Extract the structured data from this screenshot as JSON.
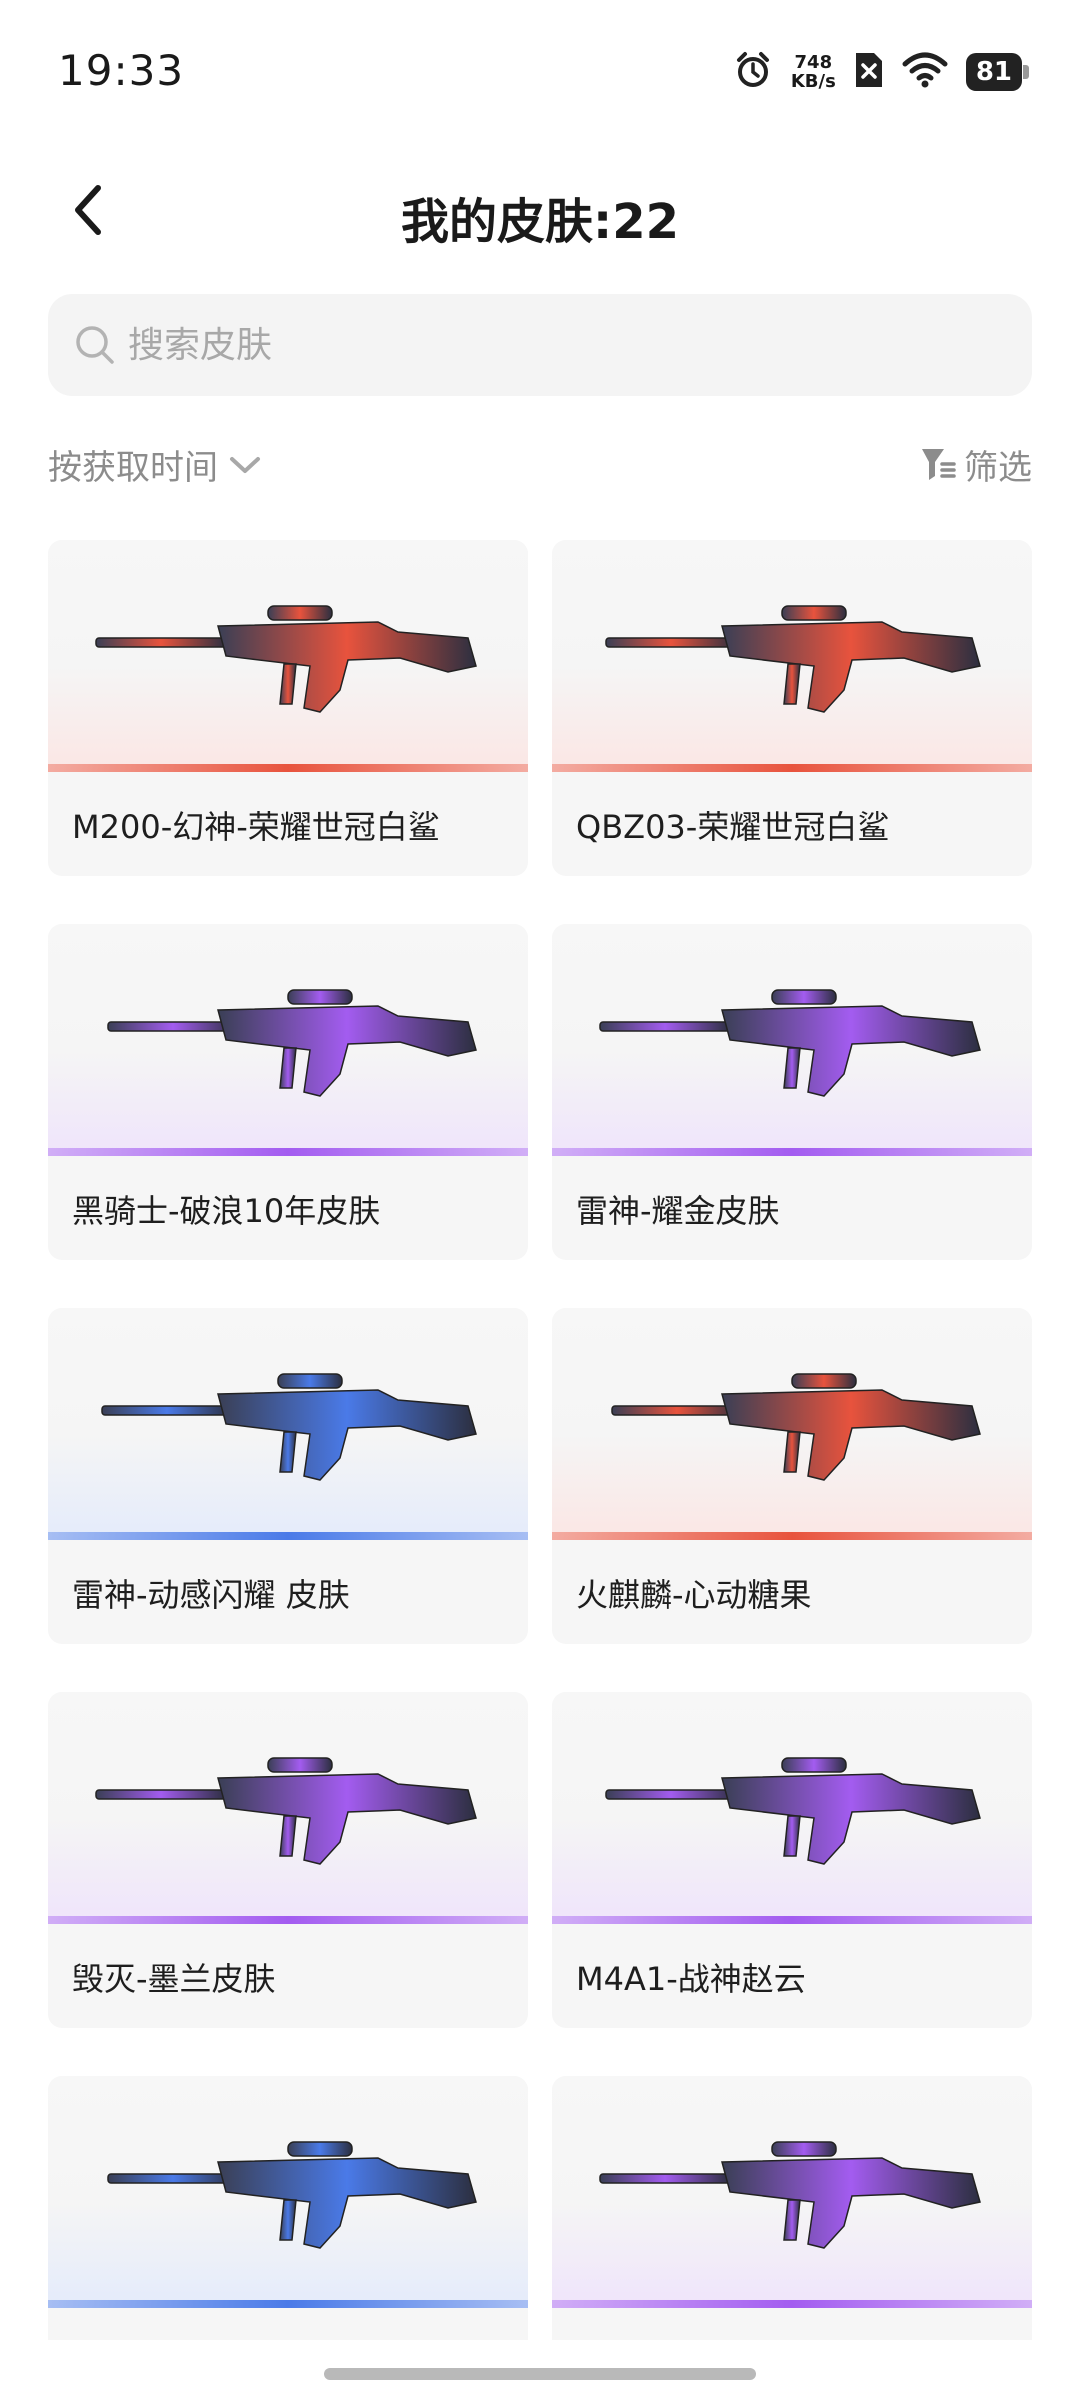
{
  "status_bar": {
    "time": "19:33",
    "speed_value": "748",
    "speed_unit": "KB/s",
    "battery": "81",
    "icons": [
      "alarm-icon",
      "network-speed",
      "sim-off-icon",
      "wifi-icon",
      "battery-icon"
    ]
  },
  "header": {
    "title": "我的皮肤:22",
    "back_icon": "chevron-left-icon"
  },
  "search": {
    "placeholder": "搜索皮肤",
    "value": ""
  },
  "controls": {
    "sort_label": "按获取时间",
    "filter_label": "筛选"
  },
  "colors": {
    "red_rarity": "#e8533d",
    "purple_rarity": "#a35cf0",
    "blue_rarity": "#4a7ae8"
  },
  "skins": [
    {
      "name": "M200-幻神-荣耀世冠白鲨",
      "rarity": "red"
    },
    {
      "name": "QBZ03-荣耀世冠白鲨",
      "rarity": "red"
    },
    {
      "name": "黑骑士-破浪10年皮肤",
      "rarity": "purple"
    },
    {
      "name": "雷神-耀金皮肤",
      "rarity": "purple"
    },
    {
      "name": "雷神-动感闪耀 皮肤",
      "rarity": "blue"
    },
    {
      "name": "火麒麟-心动糖果",
      "rarity": "red"
    },
    {
      "name": "毁灭-墨兰皮肤",
      "rarity": "purple"
    },
    {
      "name": "M4A1-战神赵云",
      "rarity": "purple"
    },
    {
      "name": "",
      "rarity": "blue"
    },
    {
      "name": "",
      "rarity": "purple"
    }
  ]
}
